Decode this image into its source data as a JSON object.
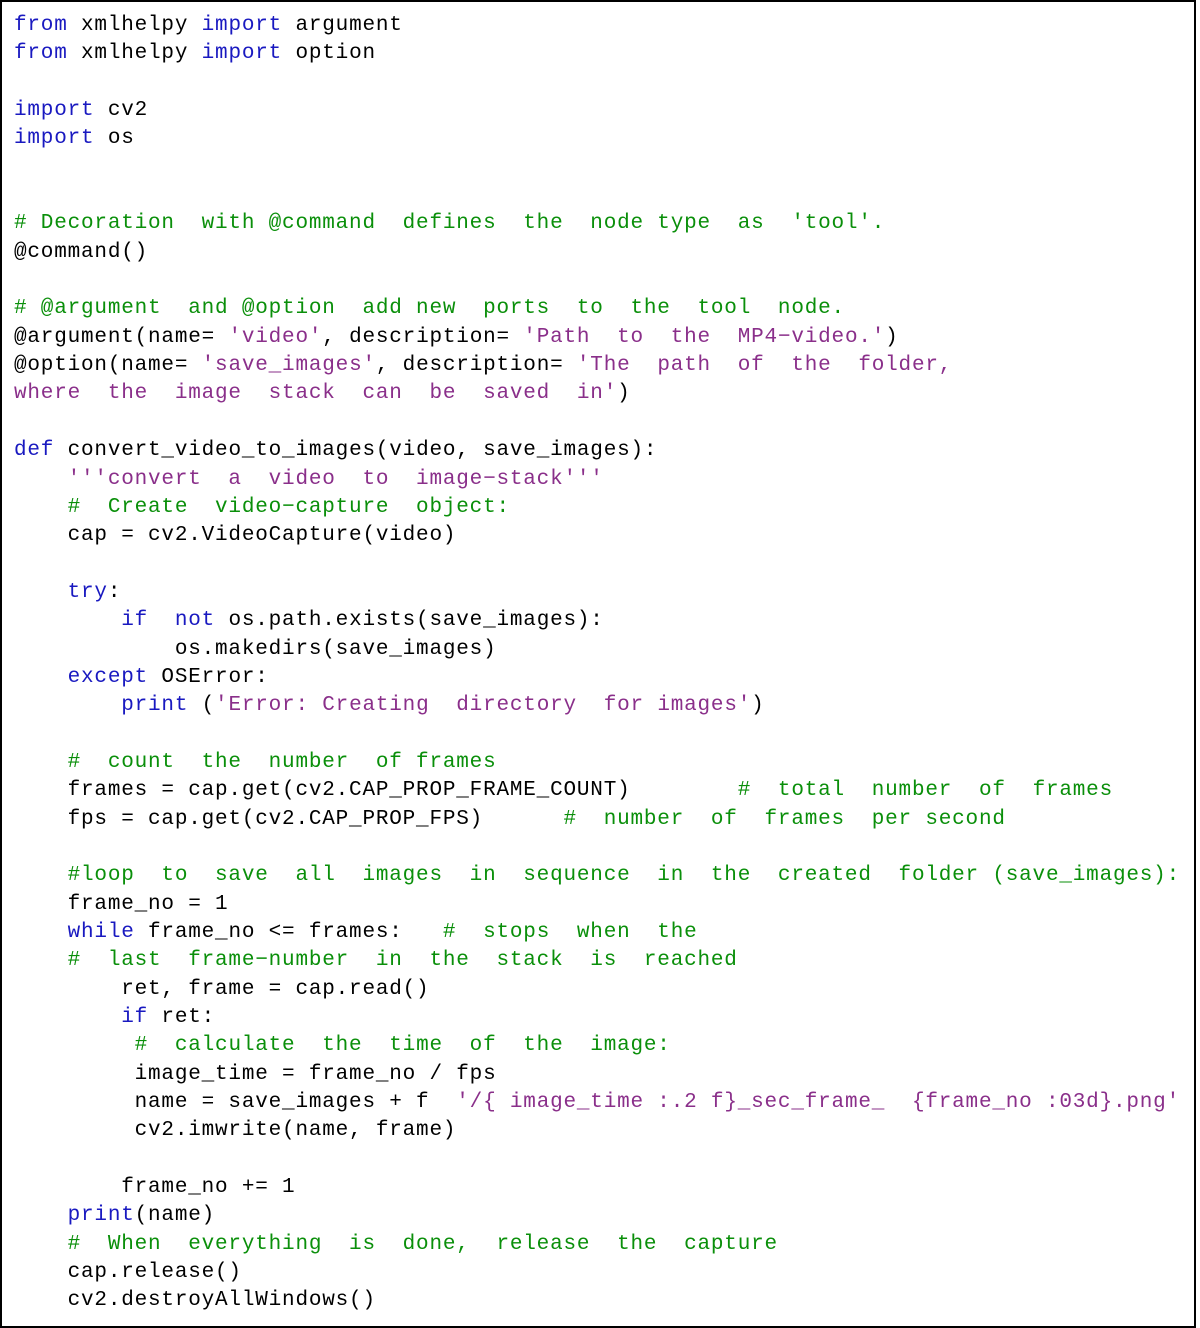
{
  "code": {
    "lines": [
      [
        {
          "cls": "kw",
          "t": "from"
        },
        {
          "cls": "",
          "t": " xmlhelpy "
        },
        {
          "cls": "kw",
          "t": "import"
        },
        {
          "cls": "",
          "t": " argument"
        }
      ],
      [
        {
          "cls": "kw",
          "t": "from"
        },
        {
          "cls": "",
          "t": " xmlhelpy "
        },
        {
          "cls": "kw",
          "t": "import"
        },
        {
          "cls": "",
          "t": " option"
        }
      ],
      [
        {
          "cls": "",
          "t": ""
        }
      ],
      [
        {
          "cls": "kw",
          "t": "import"
        },
        {
          "cls": "",
          "t": " cv2"
        }
      ],
      [
        {
          "cls": "kw",
          "t": "import"
        },
        {
          "cls": "",
          "t": " os"
        }
      ],
      [
        {
          "cls": "",
          "t": ""
        }
      ],
      [
        {
          "cls": "",
          "t": ""
        }
      ],
      [
        {
          "cls": "cm",
          "t": "# Decoration  with @command  defines  the  node type  as  'tool'."
        }
      ],
      [
        {
          "cls": "",
          "t": "@command()"
        }
      ],
      [
        {
          "cls": "",
          "t": ""
        }
      ],
      [
        {
          "cls": "cm",
          "t": "# @argument  and @option  add new  ports  to  the  tool  node."
        }
      ],
      [
        {
          "cls": "",
          "t": "@argument(name= "
        },
        {
          "cls": "str",
          "t": "'video'"
        },
        {
          "cls": "",
          "t": ", description= "
        },
        {
          "cls": "str",
          "t": "'Path  to  the  MP4−video.'"
        },
        {
          "cls": "",
          "t": ")"
        }
      ],
      [
        {
          "cls": "",
          "t": "@option(name= "
        },
        {
          "cls": "str",
          "t": "'save_images'"
        },
        {
          "cls": "",
          "t": ", description= "
        },
        {
          "cls": "str",
          "t": "'The  path  of  the  folder,"
        }
      ],
      [
        {
          "cls": "str",
          "t": "where  the  image  stack  can  be  saved  in'"
        },
        {
          "cls": "",
          "t": ")"
        }
      ],
      [
        {
          "cls": "",
          "t": ""
        }
      ],
      [
        {
          "cls": "kw",
          "t": "def"
        },
        {
          "cls": "",
          "t": " convert_video_to_images(video, save_images):"
        }
      ],
      [
        {
          "cls": "",
          "t": "    "
        },
        {
          "cls": "str",
          "t": "'''convert  a  video  to  image−stack'''"
        }
      ],
      [
        {
          "cls": "",
          "t": "    "
        },
        {
          "cls": "cm",
          "t": "#  Create  video−capture  object:"
        }
      ],
      [
        {
          "cls": "",
          "t": "    cap = cv2.VideoCapture(video)"
        }
      ],
      [
        {
          "cls": "",
          "t": ""
        }
      ],
      [
        {
          "cls": "",
          "t": "    "
        },
        {
          "cls": "kw",
          "t": "try"
        },
        {
          "cls": "",
          "t": ":"
        }
      ],
      [
        {
          "cls": "",
          "t": "        "
        },
        {
          "cls": "kw",
          "t": "if  not"
        },
        {
          "cls": "",
          "t": " os.path.exists(save_images):"
        }
      ],
      [
        {
          "cls": "",
          "t": "            os.makedirs(save_images)"
        }
      ],
      [
        {
          "cls": "",
          "t": "    "
        },
        {
          "cls": "kw",
          "t": "except"
        },
        {
          "cls": "",
          "t": " OSError:"
        }
      ],
      [
        {
          "cls": "",
          "t": "        "
        },
        {
          "cls": "kw",
          "t": "print"
        },
        {
          "cls": "",
          "t": " ("
        },
        {
          "cls": "str",
          "t": "'Error: Creating  directory  for images'"
        },
        {
          "cls": "",
          "t": ")"
        }
      ],
      [
        {
          "cls": "",
          "t": ""
        }
      ],
      [
        {
          "cls": "",
          "t": "    "
        },
        {
          "cls": "cm",
          "t": "#  count  the  number  of frames"
        }
      ],
      [
        {
          "cls": "",
          "t": "    frames = cap.get(cv2.CAP_PROP_FRAME_COUNT)        "
        },
        {
          "cls": "cm",
          "t": "#  total  number  of  frames"
        }
      ],
      [
        {
          "cls": "",
          "t": "    fps = cap.get(cv2.CAP_PROP_FPS)      "
        },
        {
          "cls": "cm",
          "t": "#  number  of  frames  per second"
        }
      ],
      [
        {
          "cls": "",
          "t": ""
        }
      ],
      [
        {
          "cls": "",
          "t": "    "
        },
        {
          "cls": "cm",
          "t": "#loop  to  save  all  images  in  sequence  in  the  created  folder (save_images):"
        }
      ],
      [
        {
          "cls": "",
          "t": "    frame_no = 1"
        }
      ],
      [
        {
          "cls": "",
          "t": "    "
        },
        {
          "cls": "kw",
          "t": "while"
        },
        {
          "cls": "",
          "t": " frame_no <= frames:   "
        },
        {
          "cls": "cm",
          "t": "#  stops  when  the"
        }
      ],
      [
        {
          "cls": "",
          "t": "    "
        },
        {
          "cls": "cm",
          "t": "#  last  frame−number  in  the  stack  is  reached"
        }
      ],
      [
        {
          "cls": "",
          "t": "        ret, frame = cap.read()"
        }
      ],
      [
        {
          "cls": "",
          "t": "        "
        },
        {
          "cls": "kw",
          "t": "if"
        },
        {
          "cls": "",
          "t": " ret:"
        }
      ],
      [
        {
          "cls": "",
          "t": "         "
        },
        {
          "cls": "cm",
          "t": "#  calculate  the  time  of  the  image:"
        }
      ],
      [
        {
          "cls": "",
          "t": "         image_time = frame_no / fps"
        }
      ],
      [
        {
          "cls": "",
          "t": "         name = save_images + f  "
        },
        {
          "cls": "str",
          "t": "'/{ image_time :.2 f}_sec_frame_  {frame_no :03d}.png'"
        }
      ],
      [
        {
          "cls": "",
          "t": "         cv2.imwrite(name, frame)"
        }
      ],
      [
        {
          "cls": "",
          "t": ""
        }
      ],
      [
        {
          "cls": "",
          "t": "        frame_no += 1"
        }
      ],
      [
        {
          "cls": "",
          "t": "    "
        },
        {
          "cls": "kw",
          "t": "print"
        },
        {
          "cls": "",
          "t": "(name)"
        }
      ],
      [
        {
          "cls": "",
          "t": "    "
        },
        {
          "cls": "cm",
          "t": "#  When  everything  is  done,  release  the  capture"
        }
      ],
      [
        {
          "cls": "",
          "t": "    cap.release()"
        }
      ],
      [
        {
          "cls": "",
          "t": "    cv2.destroyAllWindows()"
        }
      ]
    ]
  }
}
